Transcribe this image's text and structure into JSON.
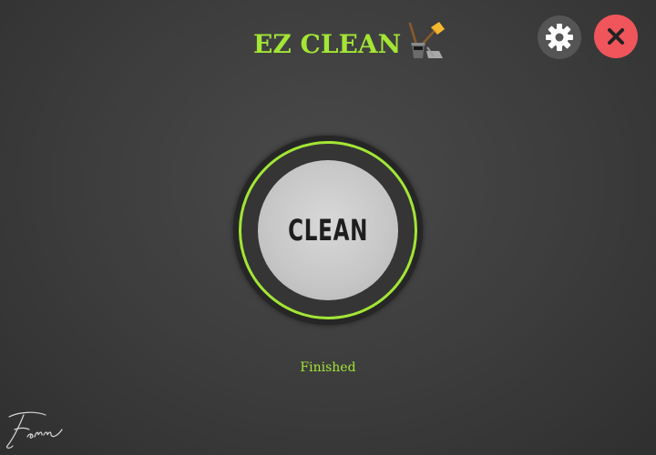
{
  "header": {
    "title": "EZ CLEAN",
    "logo_icon": "broom-bucket-icon"
  },
  "toolbar": {
    "settings_icon": "gear-icon",
    "close_icon": "close-icon"
  },
  "main": {
    "clean_button_label": "CLEAN",
    "status_text": "Finished"
  },
  "footer": {
    "signature": "Ferrer"
  },
  "colors": {
    "accent": "#a3e635",
    "close_button": "#f0555b",
    "settings_button": "#555555",
    "background": "#3c3c3c"
  }
}
